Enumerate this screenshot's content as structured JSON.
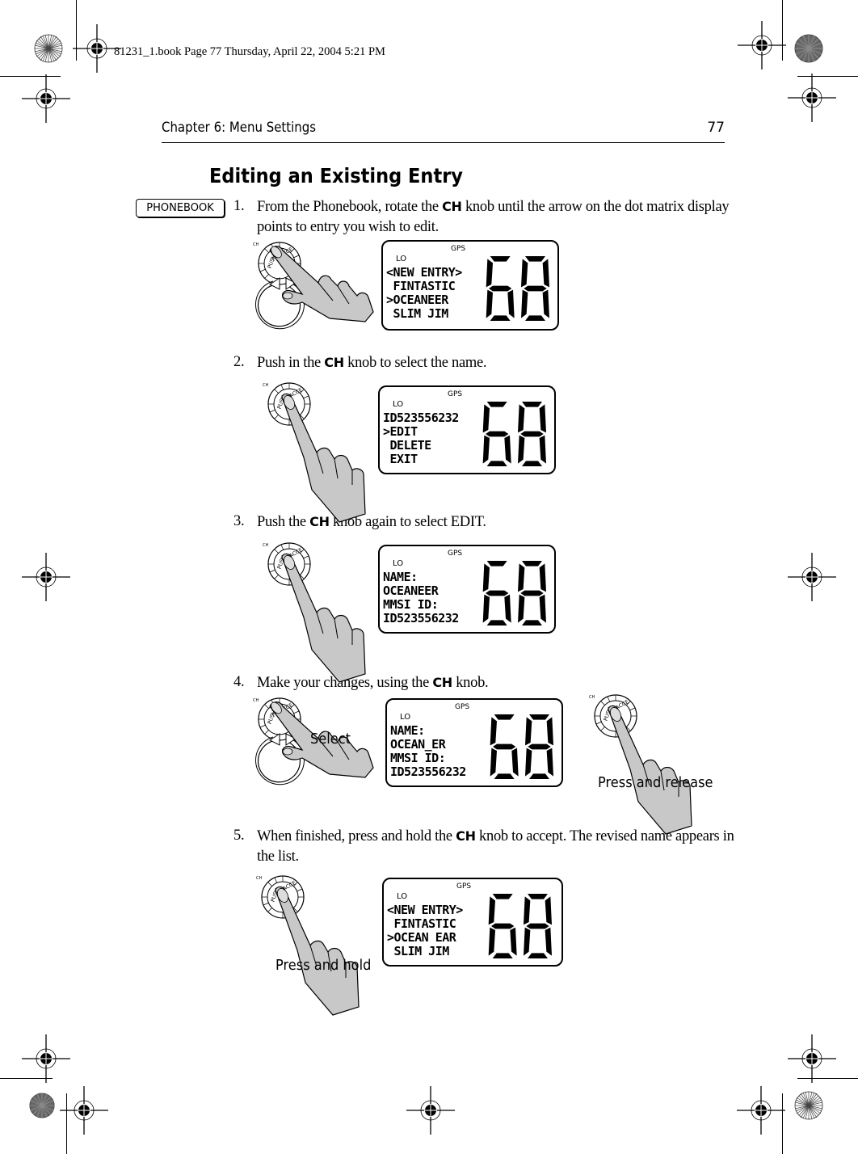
{
  "print_slug": "81231_1.book  Page 77  Thursday, April 22, 2004  5:21 PM",
  "running_head": {
    "chapter": "Chapter 6: Menu Settings",
    "page_number": "77"
  },
  "section_title": "Editing an Existing Entry",
  "side_key_label": "PHONEBOOK",
  "control_name": "CH",
  "steps": [
    {
      "number": "1.",
      "text_before": "From the Phonebook, rotate the ",
      "text_after": " knob until the arrow on the dot matrix display points to entry you wish to edit.",
      "display": {
        "gps": "GPS",
        "lo": "LO",
        "lines": [
          "<NEW ENTRY>",
          " FINTASTIC",
          ">OCEANEER",
          " SLIM JIM"
        ],
        "channel": "68"
      },
      "knob_action": "rotate"
    },
    {
      "number": "2.",
      "text_before": "Push in the ",
      "text_after": " knob to select the name.",
      "display": {
        "gps": "GPS",
        "lo": "LO",
        "lines": [
          "ID523556232",
          ">EDIT",
          " DELETE",
          " EXIT"
        ],
        "channel": "68"
      },
      "knob_action": "push"
    },
    {
      "number": "3.",
      "text_before": "Push the ",
      "text_after": " knob again to select EDIT.",
      "display": {
        "gps": "GPS",
        "lo": "LO",
        "lines": [
          "NAME:",
          "OCEANEER",
          "MMSI ID:",
          "ID523556232"
        ],
        "channel": "68"
      },
      "knob_action": "push"
    },
    {
      "number": "4.",
      "text_before": "Make your changes, using the ",
      "text_after": " knob.",
      "display": {
        "gps": "GPS",
        "lo": "LO",
        "lines": [
          "NAME:",
          "OCEAN_ER",
          "MMSI ID:",
          "ID523556232"
        ],
        "channel": "68"
      },
      "knob_action": "rotate",
      "left_caption": "Select",
      "right_caption": "Press and release"
    },
    {
      "number": "5.",
      "text_before": "When finished, press and hold the ",
      "text_after": " knob to accept. The revised name appears in the list.",
      "display": {
        "gps": "GPS",
        "lo": "LO",
        "lines": [
          "<NEW ENTRY>",
          " FINTASTIC",
          ">OCEAN EAR",
          " SLIM JIM"
        ],
        "channel": "68"
      },
      "knob_action": "push",
      "left_caption": "Press and hold"
    }
  ],
  "knob_labels": {
    "ch": "CH",
    "ring_text": "PUSH TO ACCEPT"
  }
}
